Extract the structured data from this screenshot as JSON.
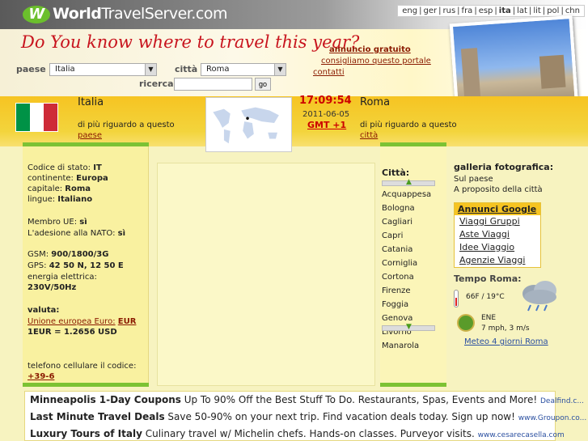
{
  "header": {
    "logo_world": "World",
    "logo_travel": "TravelServer.com",
    "languages": [
      "eng",
      "ger",
      "rus",
      "fra",
      "esp",
      "ita",
      "lat",
      "lit",
      "pol",
      "chn"
    ],
    "selected_language": "ita",
    "slogan": "Do You know where to travel this year?"
  },
  "promo": {
    "ad": "annuncio gratuito",
    "recommend": "consigliamo questo portale",
    "contacts": "contatti"
  },
  "search": {
    "country_label": "paese",
    "country_value": "Italia",
    "city_label": "città",
    "city_value": "Roma",
    "search_label": "ricerca",
    "search_value": "",
    "go_label": "go"
  },
  "country": {
    "name": "Italia",
    "more": "di più riguardo a questo",
    "more_link": "paese",
    "flag_colors": [
      "#009246",
      "#ffffff",
      "#ce2b37"
    ]
  },
  "clock": {
    "time": "17:09:54",
    "date": "2011-06-05",
    "gmt": "GMT +1"
  },
  "city": {
    "name": "Roma",
    "more": "di più riguardo a questo",
    "more_link": "città"
  },
  "facts": {
    "code_label": "Codice di stato:",
    "code": "IT",
    "continent_label": "continente:",
    "continent": "Europa",
    "capital_label": "capitale:",
    "capital": "Roma",
    "languages_label": "lingue:",
    "languages": "Italiano",
    "eu_label": "Membro UE:",
    "eu": "sì",
    "nato_label": "L'adesione alla NATO:",
    "nato": "sì",
    "gsm_label": "GSM:",
    "gsm": "900/1800/3G",
    "gps_label": "GPS:",
    "gps": "42 50 N, 12 50 E",
    "energy_label": "energia elettrica:",
    "energy": "230V/50Hz",
    "currency_label": "valuta:",
    "currency_name": "Unione europea Euro:",
    "currency_code": "EUR",
    "rate": "1EUR = 1.2656 USD",
    "phone_label": "telefono cellulare il codice:",
    "phone_code": "+39-6"
  },
  "cities": {
    "title": "Città:",
    "items": [
      "Acquappesa",
      "Bologna",
      "Cagliari",
      "Capri",
      "Catania",
      "Corniglia",
      "Cortona",
      "Firenze",
      "Foggia",
      "Genova",
      "Livorno",
      "Manarola"
    ]
  },
  "gallery": {
    "title": "galleria fotografica:",
    "link1": "Sul paese",
    "link2": "A proposito della città"
  },
  "google_ads": {
    "title": "Annunci Google",
    "items": [
      "Viaggi Gruppi",
      "Aste Viaggi",
      "Idee Viaggio",
      "Agenzie Viaggi"
    ]
  },
  "weather": {
    "title": "Tempo Roma:",
    "temp": "66F / 19°C",
    "wind_dir": "ENE",
    "wind_speed": "7 mph, 3 m/s",
    "forecast_link": "Meteo 4 giorni Roma"
  },
  "bottom_ads": [
    {
      "title": "Minneapolis 1-Day Coupons",
      "text": "Up To 90% Off the Best Stuff To Do. Restaurants, Spas, Events and More!",
      "url": "Dealfind.c..."
    },
    {
      "title": "Last Minute Travel Deals",
      "text": "Save 50-90% on your next trip. Find vacation deals today. Sign up now!",
      "url": "www.Groupon.co..."
    },
    {
      "title": "Luxury Tours of Italy",
      "text": "Culinary travel w/ Michelin chefs. Hands-on classes. Purveyor visits.",
      "url": "www.cesarecasella.com"
    }
  ]
}
